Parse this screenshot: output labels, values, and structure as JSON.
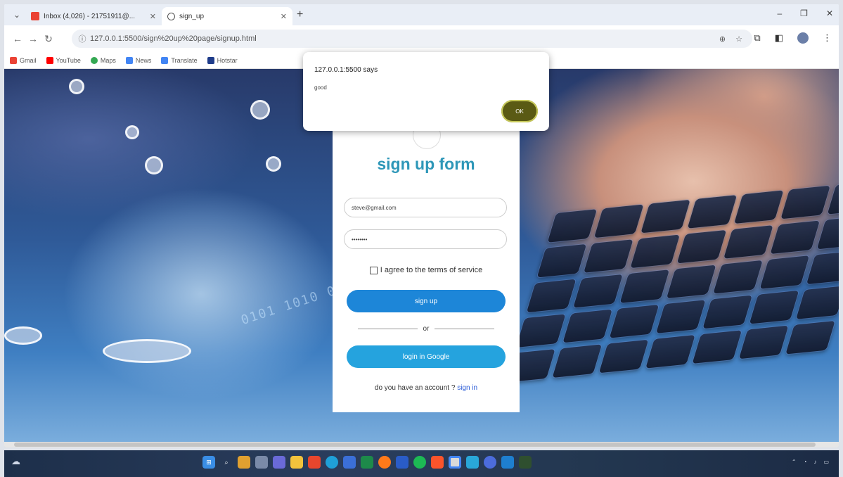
{
  "browser": {
    "tabs": [
      {
        "label": "Inbox (4,026) - 21751911@...",
        "active": false
      },
      {
        "label": "sign_up",
        "active": true
      }
    ],
    "new_tab": "+",
    "url": "127.0.0.1:5500/sign%20up%20page/signup.html"
  },
  "bookmarks": [
    {
      "label": "Gmail",
      "color": "#ea4335"
    },
    {
      "label": "YouTube",
      "color": "#ff0000"
    },
    {
      "label": "Maps",
      "color": "#34a853"
    },
    {
      "label": "News",
      "color": "#4285f4"
    },
    {
      "label": "Translate",
      "color": "#4285f4"
    },
    {
      "label": "Hotstar",
      "color": "#1f3c8a"
    }
  ],
  "dialog": {
    "origin": "127.0.0.1:5500 says",
    "message": "good",
    "ok_label": "OK"
  },
  "form": {
    "title": "sign up form",
    "email_value": "steve@gmail.com",
    "password_value": "••••••••",
    "agree_label": "I agree to the terms of service",
    "signup_label": "sign up",
    "or_label": "or",
    "google_label": "login in Google",
    "account_text": "do you have an account ? ",
    "signin_link": "sign in"
  },
  "colors": {
    "title": "#2e97b8",
    "signup_button": "#1d86d8",
    "google_button": "#25a3de",
    "ok_button": "#5a5a14"
  }
}
